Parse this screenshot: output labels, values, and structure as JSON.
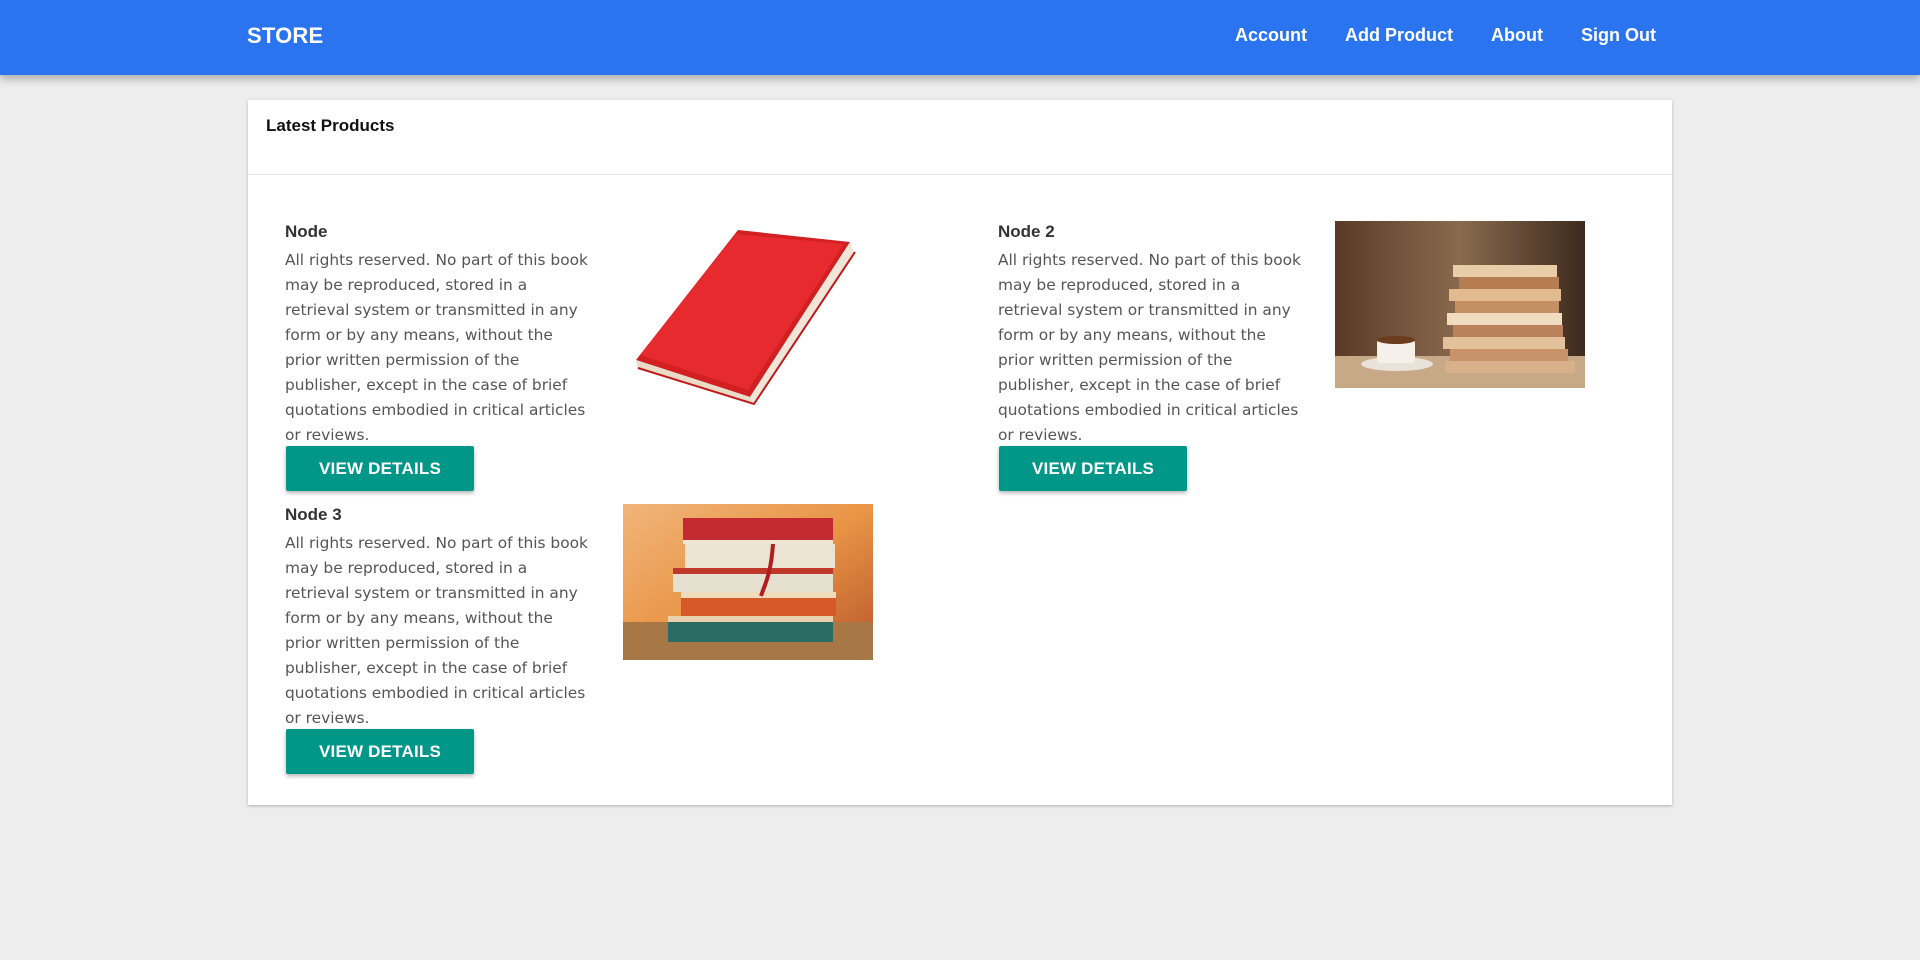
{
  "header": {
    "brand": "STORE",
    "nav": [
      "Account",
      "Add Product",
      "About",
      "Sign Out"
    ]
  },
  "card": {
    "title": "Latest Products"
  },
  "products": [
    {
      "title": "Node",
      "description": "All rights reserved. No part of this book may be reproduced, stored in a retrieval system or transmitted in any form or by any means, without the prior written permission of the publisher, except in the case of brief quotations embodied in critical articles or reviews.",
      "button": "VIEW DETAILS",
      "image": "red-book-image"
    },
    {
      "title": "Node 2",
      "description": "All rights reserved. No part of this book may be reproduced, stored in a retrieval system or transmitted in any form or by any means, without the prior written permission of the publisher, except in the case of brief quotations embodied in critical articles or reviews.",
      "button": "VIEW DETAILS",
      "image": "book-stack-coffee-image"
    },
    {
      "title": "Node 3",
      "description": "All rights reserved. No part of this book may be reproduced, stored in a retrieval system or transmitted in any form or by any means, without the prior written permission of the publisher, except in the case of brief quotations embodied in critical articles or reviews.",
      "button": "VIEW DETAILS",
      "image": "book-stack-autumn-image"
    }
  ],
  "colors": {
    "header": "#2a74ef",
    "button": "#009688",
    "background": "#ededed"
  }
}
